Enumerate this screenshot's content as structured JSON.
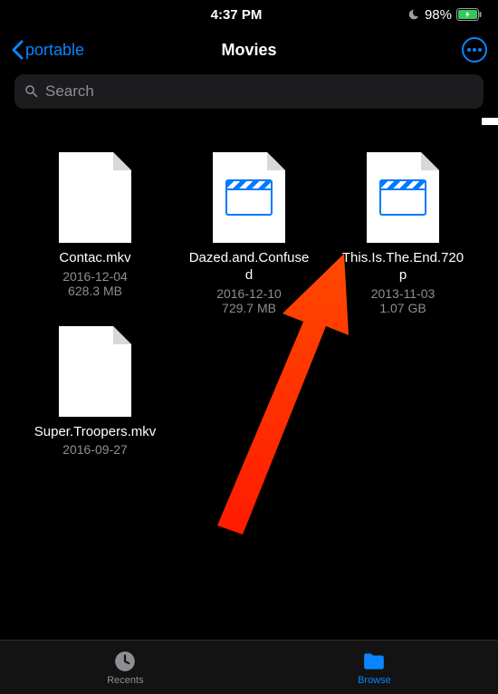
{
  "status": {
    "time": "4:37 PM",
    "battery_pct": "98%"
  },
  "nav": {
    "back_label": "portable",
    "title": "Movies"
  },
  "search": {
    "placeholder": "Search"
  },
  "files": [
    {
      "name": "Contac.mkv",
      "date": "2016-12-04",
      "size": "628.3 MB",
      "has_video_thumb": false
    },
    {
      "name": "Dazed.and.Confused",
      "date": "2016-12-10",
      "size": "729.7 MB",
      "has_video_thumb": true
    },
    {
      "name": "This.Is.The.End.720p",
      "date": "2013-11-03",
      "size": "1.07 GB",
      "has_video_thumb": true
    },
    {
      "name": "Super.Troopers.mkv",
      "date": "2016-09-27",
      "size": "",
      "has_video_thumb": false
    }
  ],
  "tabs": {
    "recents": "Recents",
    "browse": "Browse"
  }
}
